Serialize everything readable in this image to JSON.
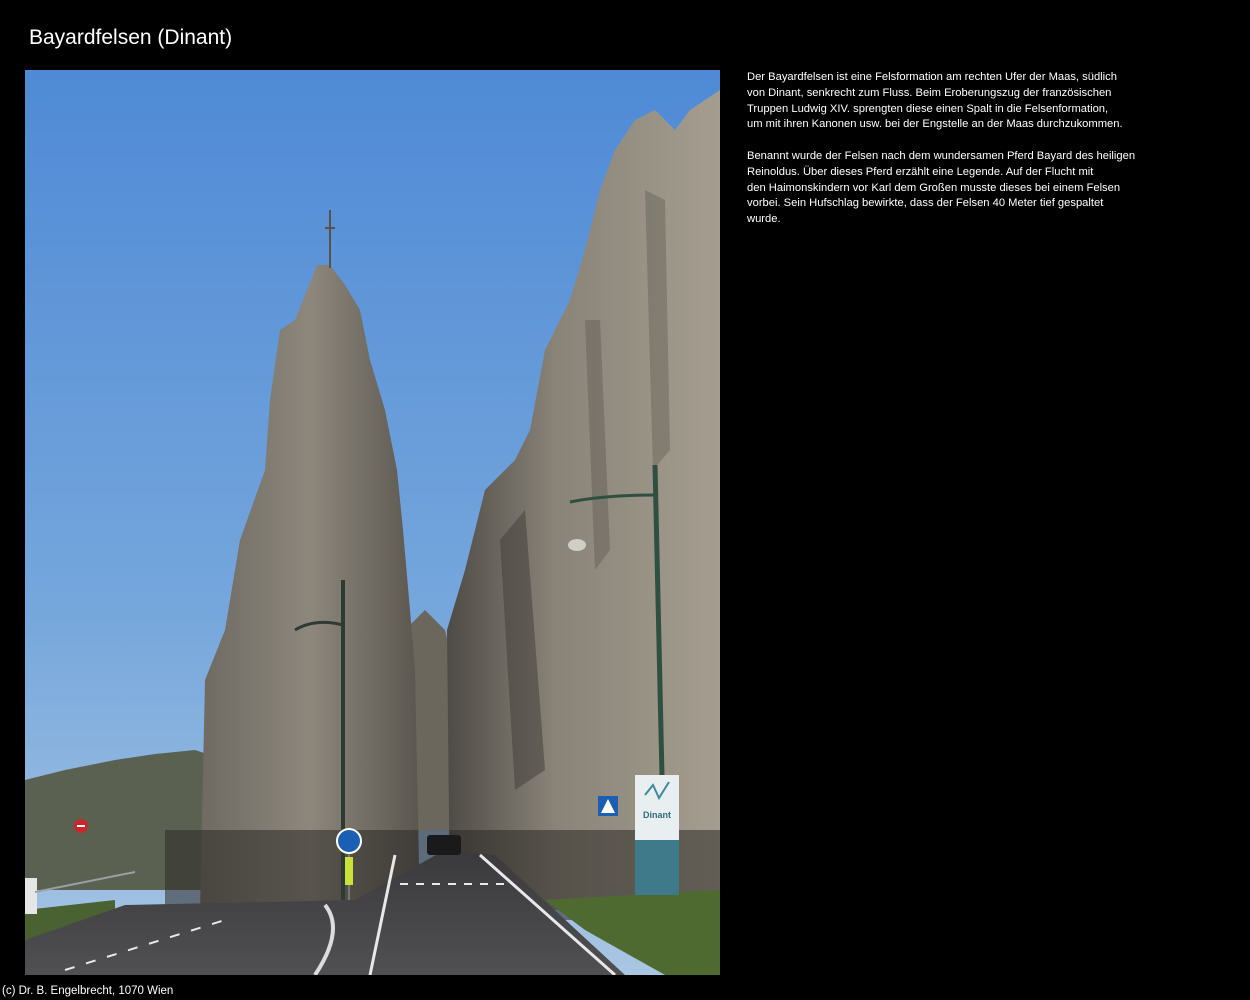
{
  "page": {
    "title": "Bayardfelsen (Dinant)",
    "footer": "(c) Dr. B. Engelbrecht, 1070 Wien"
  },
  "photo": {
    "sign_text": "Dinant"
  },
  "description": {
    "paragraphs": [
      "Der Bayardfelsen ist eine Felsformation am rechten Ufer der Maas, südlich\nvon Dinant, senkrecht zum Fluss. Beim Eroberungszug der französischen\nTruppen Ludwig XIV. sprengten diese einen Spalt in die Felsenformation,\num mit ihren Kanonen usw. bei der Engstelle an der Maas durchzukommen.",
      "Benannt wurde der Felsen nach dem wundersamen Pferd Bayard des heiligen\nReinoldus. Über dieses Pferd erzählt eine Legende. Auf der Flucht mit\nden Haimonskindern vor Karl dem Großen musste dieses bei einem Felsen\nvorbei. Sein Hufschlag bewirkte, dass der Felsen 40 Meter tief gespaltet\nwurde."
    ]
  },
  "colors": {
    "background": "#000000",
    "text": "#ffffff",
    "sky": "#6a9ad6",
    "rock": "#8a8478"
  }
}
